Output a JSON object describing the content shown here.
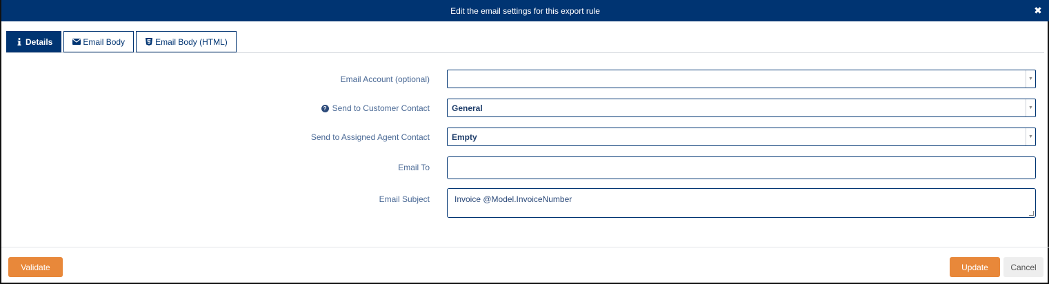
{
  "dialog": {
    "title": "Edit the email settings for this export rule"
  },
  "tabs": [
    {
      "label": "Details",
      "icon": "info-icon",
      "active": true
    },
    {
      "label": "Email Body",
      "icon": "envelope-icon",
      "active": false
    },
    {
      "label": "Email Body (HTML)",
      "icon": "html5-icon",
      "active": false
    }
  ],
  "form": {
    "email_account": {
      "label": "Email Account (optional)",
      "value": ""
    },
    "customer_contact": {
      "label": "Send to Customer Contact",
      "value": "General"
    },
    "agent_contact": {
      "label": "Send to Assigned Agent Contact",
      "value": "Empty"
    },
    "email_to": {
      "label": "Email To",
      "value": ""
    },
    "email_subject": {
      "label": "Email Subject",
      "value": "Invoice @Model.InvoiceNumber"
    }
  },
  "buttons": {
    "validate": "Validate",
    "update": "Update",
    "cancel": "Cancel"
  },
  "colors": {
    "primary": "#003472",
    "accent": "#e8883a"
  }
}
